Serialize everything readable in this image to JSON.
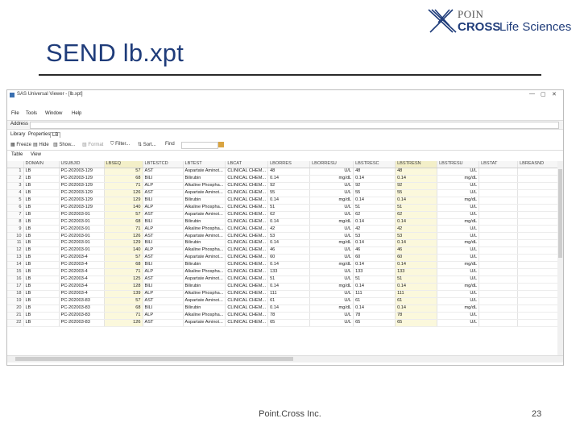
{
  "slide": {
    "title": "SEND lb.xpt",
    "footer": "Point.Cross Inc.",
    "page_number": "23"
  },
  "logo": {
    "line1": "POIN",
    "line2_bold": "CROSS",
    "line2_rest": "Life Sciences"
  },
  "app": {
    "title": "SAS Universal Viewer - [lb.xpt]",
    "window_controls": [
      "—",
      "▢",
      "✕"
    ],
    "menu": [
      "File",
      "Tools",
      "Window",
      "Help"
    ],
    "address_label": "Address",
    "tabs": [
      "Library",
      "Properties",
      "LB"
    ],
    "active_tab": "LB",
    "toolbar": [
      "Freeze",
      "Hide",
      "Show...",
      "Format",
      "Filter...",
      "Sort...",
      "Find"
    ],
    "subtabs": [
      "Table",
      "View"
    ],
    "columns": [
      "DOMAIN",
      "USUBJID",
      "LBSEQ",
      "LBTESTCD",
      "LBTEST",
      "LBCAT",
      "LBORRES",
      "LBORRESU",
      "LBSTRESC",
      "LBSTRESN",
      "LBSTRESU",
      "LBSTAT",
      "LBREASND"
    ],
    "rows": [
      [
        "1",
        "LB",
        "PC-202003-129",
        "57",
        "AST",
        "Aspartate Aminot...",
        "CLINICAL CHEM...",
        "48",
        "U/L",
        "48",
        "48",
        "U/L",
        "",
        ""
      ],
      [
        "2",
        "LB",
        "PC-202003-129",
        "68",
        "BILI",
        "Bilirubin",
        "CLINICAL CHEM...",
        "0.14",
        "mg/dL",
        "0.14",
        "0.14",
        "mg/dL",
        "",
        ""
      ],
      [
        "3",
        "LB",
        "PC-202003-129",
        "71",
        "ALP",
        "Alkaline Phospha...",
        "CLINICAL CHEM...",
        "92",
        "U/L",
        "92",
        "92",
        "U/L",
        "",
        ""
      ],
      [
        "4",
        "LB",
        "PC-202003-129",
        "126",
        "AST",
        "Aspartate Aminot...",
        "CLINICAL CHEM...",
        "55",
        "U/L",
        "55",
        "55",
        "U/L",
        "",
        ""
      ],
      [
        "5",
        "LB",
        "PC-202003-129",
        "129",
        "BILI",
        "Bilirubin",
        "CLINICAL CHEM...",
        "0.14",
        "mg/dL",
        "0.14",
        "0.14",
        "mg/dL",
        "",
        ""
      ],
      [
        "6",
        "LB",
        "PC-202003-129",
        "140",
        "ALP",
        "Alkaline Phospha...",
        "CLINICAL CHEM...",
        "51",
        "U/L",
        "51",
        "51",
        "U/L",
        "",
        ""
      ],
      [
        "7",
        "LB",
        "PC-202003-91",
        "57",
        "AST",
        "Aspartate Aminot...",
        "CLINICAL CHEM...",
        "62",
        "U/L",
        "62",
        "62",
        "U/L",
        "",
        ""
      ],
      [
        "8",
        "LB",
        "PC-202003-91",
        "68",
        "BILI",
        "Bilirubin",
        "CLINICAL CHEM...",
        "0.14",
        "mg/dL",
        "0.14",
        "0.14",
        "mg/dL",
        "",
        ""
      ],
      [
        "9",
        "LB",
        "PC-202003-91",
        "71",
        "ALP",
        "Alkaline Phospha...",
        "CLINICAL CHEM...",
        "42",
        "U/L",
        "42",
        "42",
        "U/L",
        "",
        ""
      ],
      [
        "10",
        "LB",
        "PC-202003-91",
        "126",
        "AST",
        "Aspartate Aminot...",
        "CLINICAL CHEM...",
        "53",
        "U/L",
        "53",
        "53",
        "U/L",
        "",
        ""
      ],
      [
        "11",
        "LB",
        "PC-202003-91",
        "129",
        "BILI",
        "Bilirubin",
        "CLINICAL CHEM...",
        "0.14",
        "mg/dL",
        "0.14",
        "0.14",
        "mg/dL",
        "",
        ""
      ],
      [
        "12",
        "LB",
        "PC-202003-91",
        "140",
        "ALP",
        "Alkaline Phospha...",
        "CLINICAL CHEM...",
        "46",
        "U/L",
        "46",
        "46",
        "U/L",
        "",
        ""
      ],
      [
        "13",
        "LB",
        "PC-202003-4",
        "57",
        "AST",
        "Aspartate Aminot...",
        "CLINICAL CHEM...",
        "60",
        "U/L",
        "60",
        "60",
        "U/L",
        "",
        ""
      ],
      [
        "14",
        "LB",
        "PC-202003-4",
        "68",
        "BILI",
        "Bilirubin",
        "CLINICAL CHEM...",
        "0.14",
        "mg/dL",
        "0.14",
        "0.14",
        "mg/dL",
        "",
        ""
      ],
      [
        "15",
        "LB",
        "PC-202003-4",
        "71",
        "ALP",
        "Alkaline Phospha...",
        "CLINICAL CHEM...",
        "133",
        "U/L",
        "133",
        "133",
        "U/L",
        "",
        ""
      ],
      [
        "16",
        "LB",
        "PC-202003-4",
        "125",
        "AST",
        "Aspartate Aminot...",
        "CLINICAL CHEM...",
        "51",
        "U/L",
        "51",
        "51",
        "U/L",
        "",
        ""
      ],
      [
        "17",
        "LB",
        "PC-202003-4",
        "128",
        "BILI",
        "Bilirubin",
        "CLINICAL CHEM...",
        "0.14",
        "mg/dL",
        "0.14",
        "0.14",
        "mg/dL",
        "",
        ""
      ],
      [
        "18",
        "LB",
        "PC-202003-4",
        "139",
        "ALP",
        "Alkaline Phospha...",
        "CLINICAL CHEM...",
        "111",
        "U/L",
        "111",
        "111",
        "U/L",
        "",
        ""
      ],
      [
        "19",
        "LB",
        "PC-202003-83",
        "57",
        "AST",
        "Aspartate Aminot...",
        "CLINICAL CHEM...",
        "61",
        "U/L",
        "61",
        "61",
        "U/L",
        "",
        ""
      ],
      [
        "20",
        "LB",
        "PC-202003-83",
        "68",
        "BILI",
        "Bilirubin",
        "CLINICAL CHEM...",
        "0.14",
        "mg/dL",
        "0.14",
        "0.14",
        "mg/dL",
        "",
        ""
      ],
      [
        "21",
        "LB",
        "PC-202003-83",
        "71",
        "ALP",
        "Alkaline Phospha...",
        "CLINICAL CHEM...",
        "78",
        "U/L",
        "78",
        "78",
        "U/L",
        "",
        ""
      ],
      [
        "22",
        "LB",
        "PC-202003-83",
        "126",
        "AST",
        "Aspartate Aminot...",
        "CLINICAL CHEM...",
        "65",
        "U/L",
        "65",
        "65",
        "U/L",
        "",
        ""
      ]
    ]
  }
}
